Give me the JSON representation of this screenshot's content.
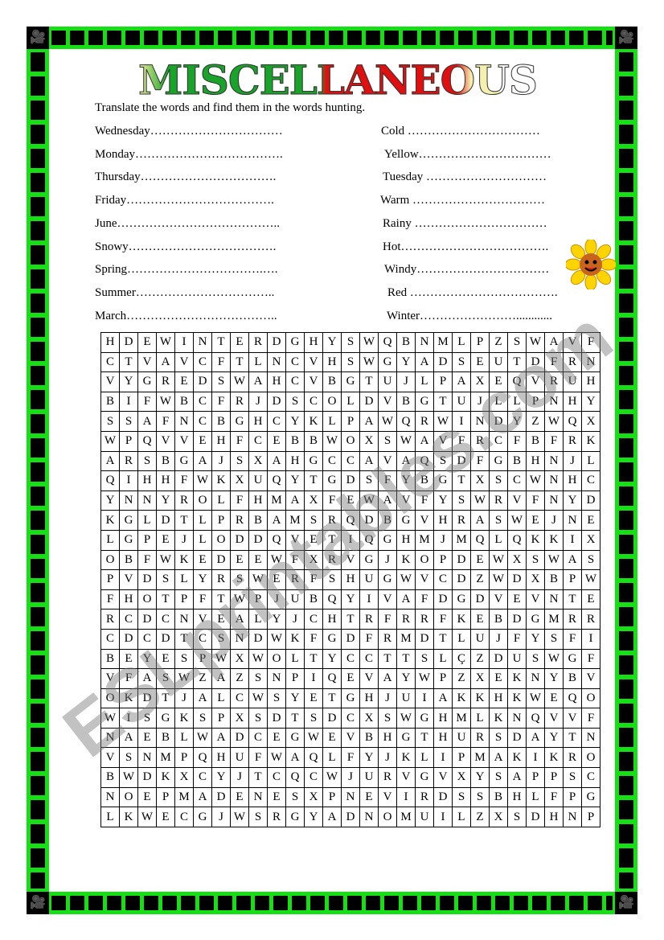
{
  "title": "MISCELLANEOUS",
  "instructions": "Translate the words and find them in the words hunting.",
  "left_words": [
    "Wednesday……………………………",
    "Monday……………………………….",
    "Thursday…………………………….",
    "Friday……………………………….",
    "June…………………………………..",
    "Snowy……………………………….",
    "Spring…………………………….….",
    "Summer……………………………..",
    "March……………………………….."
  ],
  "right_words": [
    "Cold  ……………………………",
    "Yellow……………………………",
    "Tuesday …………………………",
    "Warm  ……………………………",
    "Rainy ……………………………",
    "Hot……………………………….",
    "Windy……………………………",
    "Red ……………………………….",
    "Winter……………………............"
  ],
  "watermark": "ESLprintables.com",
  "colors": {
    "border_green": "#14e014",
    "title_green": "#1aa32a",
    "title_red": "#e01010"
  },
  "icons": {
    "corner": "film-camera-icon",
    "decoration": "sunflower-icon"
  },
  "grid": [
    "HDEWINTERDGHYSWQBNMLPZSWAVF",
    "CTVAVCFTLNCVHSWGYADSEUTDFRN",
    "VYGREDSWAHCVBGTUJLPAXEQVRUH",
    "BIFWBCFRJDSCOLDVBGTUJLLPNHY",
    "SSAFNCBGHCYKLPAWQRWINDYZWQX",
    "WPQVVEHFCEBBWOXSWAVFRCFBFRK",
    "ARSBGAJSXAHGCCAVAQSDFGBHNJL",
    "QIHHFWKXUQYTGDSFYBGTXSCWNHC",
    "YNNYROLFHMAXFEWAVFYSWRVFNYD",
    "KGLDTLPRBAMSRQDBGVHRASWEJNE",
    "LGPEJLODDQVETIQGHMJMQLQKKIX",
    "OBFWKEDEEWFXRVGJKOPDEWXSWAS",
    "PVDSLYRSWERFSHUGWVCDZWDXBPW",
    "FHOTPFTWPJUBQYIVAFDGDVEVNTE",
    "RCDCNVEALYJCHTRFRRFKEBDGMRR",
    "CDCDTCSNDWKFGDFRMDTLUJFYSFI",
    "BEYESPWXWOLTYCCTTSLÇZDUSWGF",
    "VFASWZAZSNPIQEVAYWPZXEKNYBV",
    "OKDTJALCWSYETGHJUIAKKHKWEQO",
    "WISGKSPXSDTSDCXSWGHMLKNQVVF",
    "NAEBLWADCEGWEVBHGTHURSDAYTN",
    "VSNMPQHUFWAQLFYJKLIPMAKIKRO",
    "BWDKXCYJTCQCWJURVGVXYSAPPSC",
    "NOEPMADENESXPNEVIRDSSBHLFPG",
    "LKWECGJWSRGYADNOMUILZXSDHNP"
  ]
}
